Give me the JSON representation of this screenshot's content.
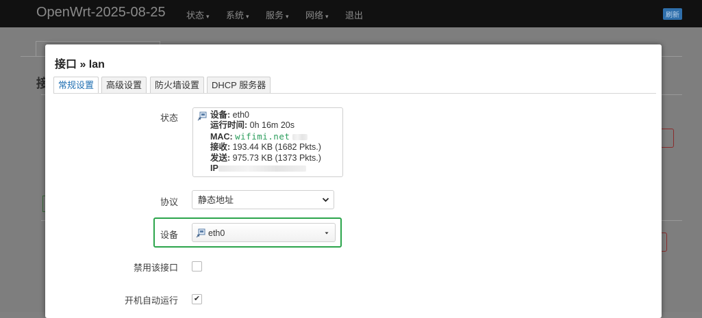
{
  "navbar": {
    "brand": "OpenWrt-2025-08-25",
    "items": [
      {
        "label": "状态",
        "caret": "▾"
      },
      {
        "label": "系统",
        "caret": "▾"
      },
      {
        "label": "服务",
        "caret": "▾"
      },
      {
        "label": "网络",
        "caret": "▾"
      },
      {
        "label": "退出",
        "caret": ""
      }
    ],
    "refresh_label": "刷新"
  },
  "background": {
    "heading_fragment": "接"
  },
  "modal": {
    "title": "接口 » lan",
    "tabs": [
      {
        "label": "常规设置",
        "active": true
      },
      {
        "label": "高级设置",
        "active": false
      },
      {
        "label": "防火墙设置",
        "active": false
      },
      {
        "label": "DHCP 服务器",
        "active": false
      }
    ],
    "status": {
      "label": "状态",
      "device_key": "设备:",
      "device_val": "eth0",
      "uptime_key": "运行时间:",
      "uptime_val": "0h 16m 20s",
      "mac_key": "MAC:",
      "mac_watermark": "wifimi.net",
      "rx_key": "接收:",
      "rx_val": "193.44 KB (1682 Pkts.)",
      "tx_key": "发送:",
      "tx_val": "975.73 KB (1373 Pkts.)",
      "ip_key": "IP"
    },
    "protocol": {
      "label": "协议",
      "selected": "静态地址"
    },
    "device": {
      "label": "设备",
      "selected": "eth0"
    },
    "disable_iface": {
      "label": "禁用该接口",
      "checked": false
    },
    "autostart": {
      "label": "开机自动运行",
      "checked": true,
      "check_glyph": "✔"
    }
  },
  "colors": {
    "highlight": "#2aa44a",
    "active_tab": "#1f6fb2",
    "watermark": "#2a9d5b"
  }
}
